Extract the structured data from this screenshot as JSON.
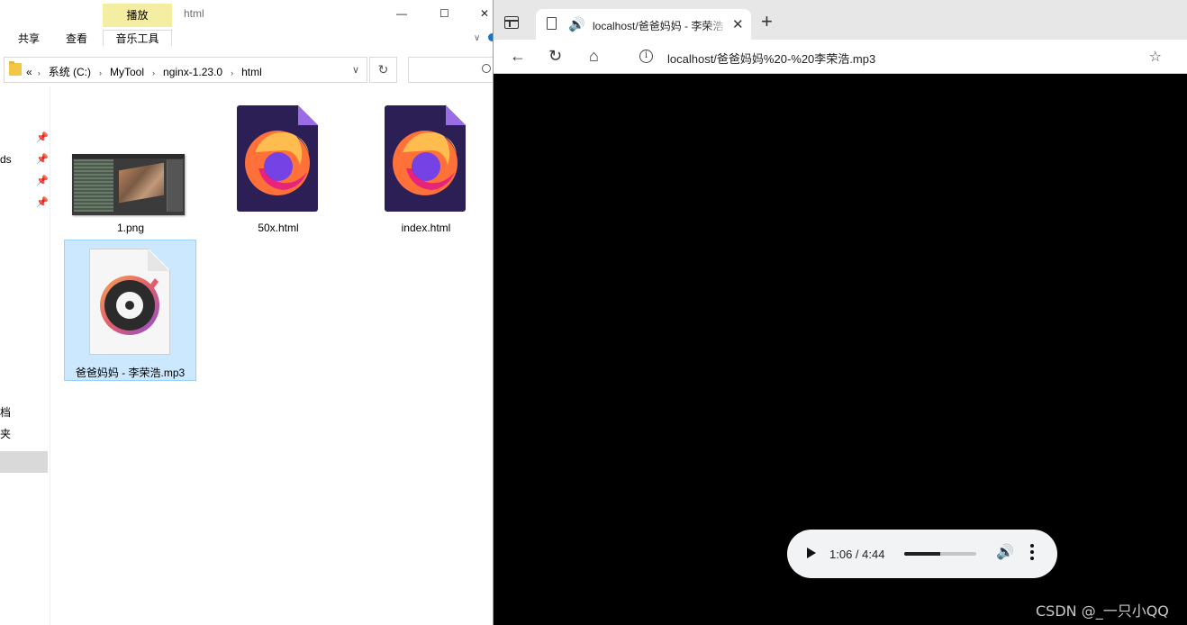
{
  "explorer": {
    "window_title": "html",
    "ribbon": {
      "context_group": "播放",
      "tabs": [
        "共享",
        "查看",
        "音乐工具"
      ]
    },
    "address": {
      "overflow": "«",
      "crumbs": [
        "系统 (C:)",
        "MyTool",
        "nginx-1.23.0",
        "html"
      ]
    },
    "nav_fragments": [
      "ds",
      "档",
      "夹"
    ],
    "files": [
      {
        "name": "1.png"
      },
      {
        "name": "50x.html"
      },
      {
        "name": "index.html"
      },
      {
        "name": "爸爸妈妈 - 李荣浩.mp3",
        "selected": true
      }
    ]
  },
  "browser": {
    "tab_title": "localhost/爸爸妈妈 - 李荣浩",
    "url": "localhost/爸爸妈妈%20-%20李荣浩.mp3",
    "player": {
      "time": "1:06 / 4:44",
      "progress": 0.5
    }
  },
  "watermark": "CSDN @_一只小QQ"
}
